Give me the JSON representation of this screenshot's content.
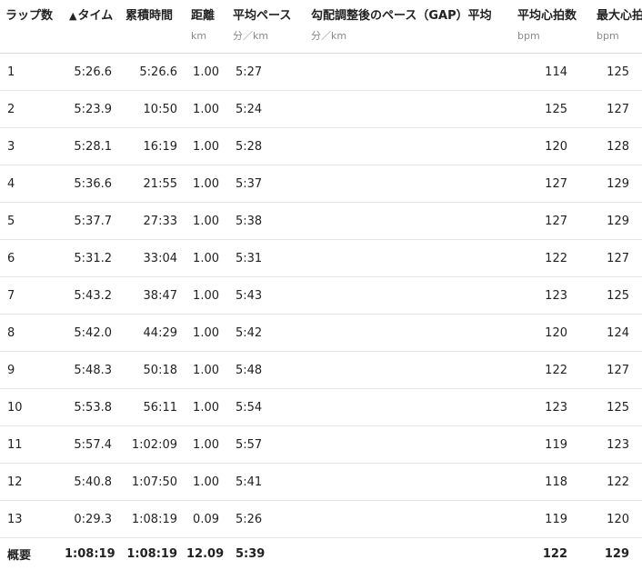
{
  "columns": {
    "lap": {
      "label": "ラップ数",
      "unit": ""
    },
    "time": {
      "label": "タイム",
      "unit": "",
      "sort_icon": "▲"
    },
    "cumulative": {
      "label": "累積時間",
      "unit": ""
    },
    "distance": {
      "label": "距離",
      "unit": "km"
    },
    "avg_pace": {
      "label": "平均ペース",
      "unit": "分／km"
    },
    "gap": {
      "label": "勾配調整後のペース（GAP）平均",
      "unit": "分／km"
    },
    "avg_hr": {
      "label": "平均心拍数",
      "unit": "bpm"
    },
    "max_hr": {
      "label": "最大心拍数",
      "unit": "bpm"
    }
  },
  "rows": [
    {
      "lap": "1",
      "time": "5:26.6",
      "cumulative": "5:26.6",
      "distance": "1.00",
      "avg_pace": "5:27",
      "gap": "",
      "avg_hr": "114",
      "max_hr": "125"
    },
    {
      "lap": "2",
      "time": "5:23.9",
      "cumulative": "10:50",
      "distance": "1.00",
      "avg_pace": "5:24",
      "gap": "",
      "avg_hr": "125",
      "max_hr": "127"
    },
    {
      "lap": "3",
      "time": "5:28.1",
      "cumulative": "16:19",
      "distance": "1.00",
      "avg_pace": "5:28",
      "gap": "",
      "avg_hr": "120",
      "max_hr": "128"
    },
    {
      "lap": "4",
      "time": "5:36.6",
      "cumulative": "21:55",
      "distance": "1.00",
      "avg_pace": "5:37",
      "gap": "",
      "avg_hr": "127",
      "max_hr": "129"
    },
    {
      "lap": "5",
      "time": "5:37.7",
      "cumulative": "27:33",
      "distance": "1.00",
      "avg_pace": "5:38",
      "gap": "",
      "avg_hr": "127",
      "max_hr": "129"
    },
    {
      "lap": "6",
      "time": "5:31.2",
      "cumulative": "33:04",
      "distance": "1.00",
      "avg_pace": "5:31",
      "gap": "",
      "avg_hr": "122",
      "max_hr": "127"
    },
    {
      "lap": "7",
      "time": "5:43.2",
      "cumulative": "38:47",
      "distance": "1.00",
      "avg_pace": "5:43",
      "gap": "",
      "avg_hr": "123",
      "max_hr": "125"
    },
    {
      "lap": "8",
      "time": "5:42.0",
      "cumulative": "44:29",
      "distance": "1.00",
      "avg_pace": "5:42",
      "gap": "",
      "avg_hr": "120",
      "max_hr": "124"
    },
    {
      "lap": "9",
      "time": "5:48.3",
      "cumulative": "50:18",
      "distance": "1.00",
      "avg_pace": "5:48",
      "gap": "",
      "avg_hr": "122",
      "max_hr": "127"
    },
    {
      "lap": "10",
      "time": "5:53.8",
      "cumulative": "56:11",
      "distance": "1.00",
      "avg_pace": "5:54",
      "gap": "",
      "avg_hr": "123",
      "max_hr": "125"
    },
    {
      "lap": "11",
      "time": "5:57.4",
      "cumulative": "1:02:09",
      "distance": "1.00",
      "avg_pace": "5:57",
      "gap": "",
      "avg_hr": "119",
      "max_hr": "123"
    },
    {
      "lap": "12",
      "time": "5:40.8",
      "cumulative": "1:07:50",
      "distance": "1.00",
      "avg_pace": "5:41",
      "gap": "",
      "avg_hr": "118",
      "max_hr": "122"
    },
    {
      "lap": "13",
      "time": "0:29.3",
      "cumulative": "1:08:19",
      "distance": "0.09",
      "avg_pace": "5:26",
      "gap": "",
      "avg_hr": "119",
      "max_hr": "120"
    }
  ],
  "summary": {
    "lap": "概要",
    "time": "1:08:19",
    "cumulative": "1:08:19",
    "distance": "12.09",
    "avg_pace": "5:39",
    "gap": "",
    "avg_hr": "122",
    "max_hr": "129"
  }
}
